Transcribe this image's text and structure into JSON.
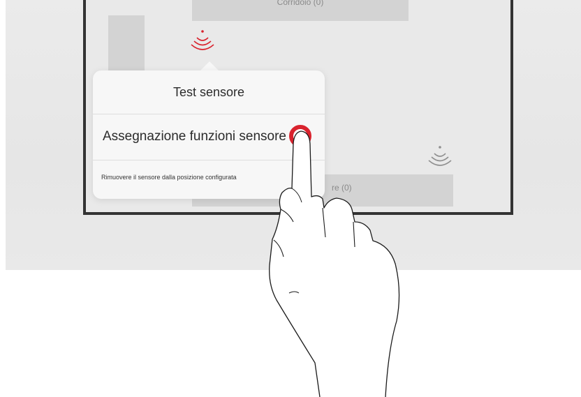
{
  "floorplan": {
    "top_block_label": "Corridoio (0)",
    "bottom_block_label": "re (0)"
  },
  "popover": {
    "items": [
      {
        "label": "Test sensore"
      },
      {
        "label": "Assegnazione funzioni sensore"
      },
      {
        "label": "Rimuovere il sensore dalla posizione configurata"
      }
    ]
  },
  "icons": {
    "sensor_selected": "wireless-sensor-icon",
    "sensor_other": "wireless-sensor-icon",
    "pointer": "hand-pointer-icon"
  },
  "colors": {
    "accent": "#d9232e",
    "sensor_gray": "#8f8f8f",
    "frame": "#333333"
  }
}
